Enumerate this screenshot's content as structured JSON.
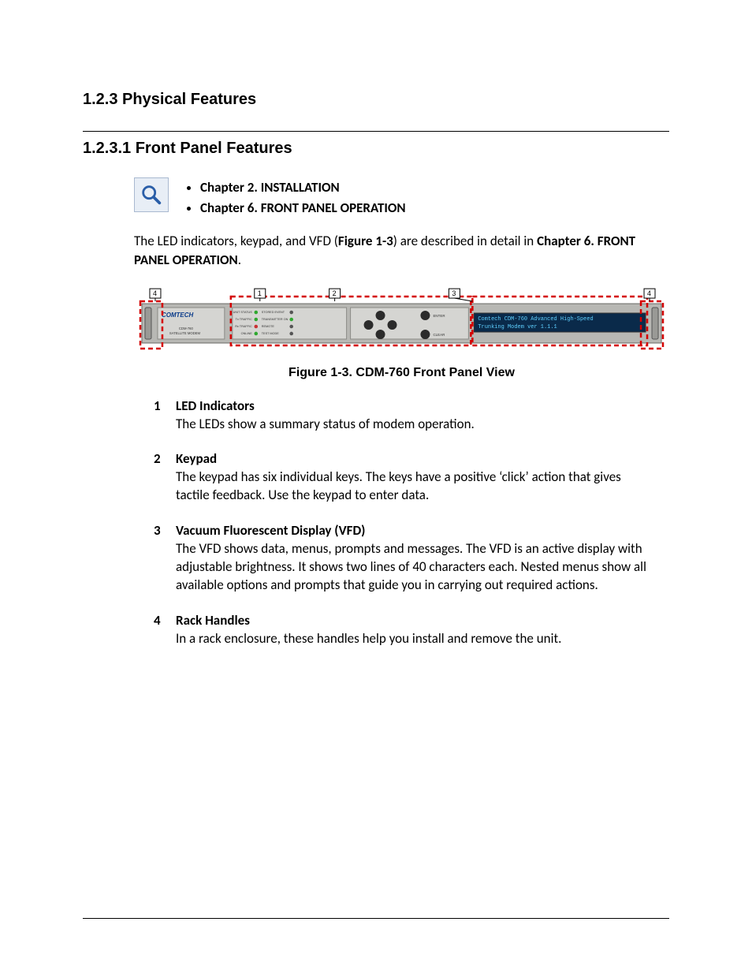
{
  "headings": {
    "section": "1.2.3  Physical Features",
    "subsection": "1.2.3.1   Front Panel Features"
  },
  "note_bullets": [
    "Chapter 2. INSTALLATION",
    "Chapter 6. FRONT PANEL OPERATION"
  ],
  "intro": {
    "pre": "The LED indicators, keypad, and VFD (",
    "figref": "Figure 1-3",
    "mid": ") are described in detail in ",
    "chapref": "Chapter 6. FRONT PANEL OPERATION",
    "post": "."
  },
  "figure": {
    "caption": "Figure 1-3. CDM-760 Front Panel View",
    "callouts": [
      "4",
      "1",
      "2",
      "3",
      "4"
    ],
    "brand": "COMTECH",
    "model_line1": "CDM-760",
    "model_line2": "SATELLITE MODEM",
    "leds": {
      "left": [
        "UNIT STATUS",
        "Tx TRAFFIC",
        "Rx TRAFFIC",
        "ONLINE"
      ],
      "right": [
        "STORED EVENT",
        "TRANSMITTER ON",
        "REMOTE",
        "TEST MODE"
      ]
    },
    "keypad": {
      "labels": [
        "ENTER",
        "CLEAR"
      ]
    },
    "vfd": {
      "line1": "Comtech CDM-760 Advanced High-Speed",
      "line2": "Trunking Modem     ver 1.1.1"
    }
  },
  "items": [
    {
      "num": "1",
      "title": "LED Indicators",
      "desc": "The LEDs show a summary status of modem operation."
    },
    {
      "num": "2",
      "title": "Keypad",
      "desc": "The keypad has six individual keys. The keys have a positive ‘click’ action that gives tactile feedback. Use the keypad to enter data."
    },
    {
      "num": "3",
      "title": "Vacuum Fluorescent Display (VFD)",
      "desc": "The VFD shows data, menus, prompts and messages. The VFD is an active display with adjustable brightness. It shows two lines of 40 characters each. Nested menus show all available options and prompts that guide you in carrying out required actions."
    },
    {
      "num": "4",
      "title": "Rack Handles",
      "desc": "In a rack enclosure, these handles help you install and remove the unit."
    }
  ]
}
